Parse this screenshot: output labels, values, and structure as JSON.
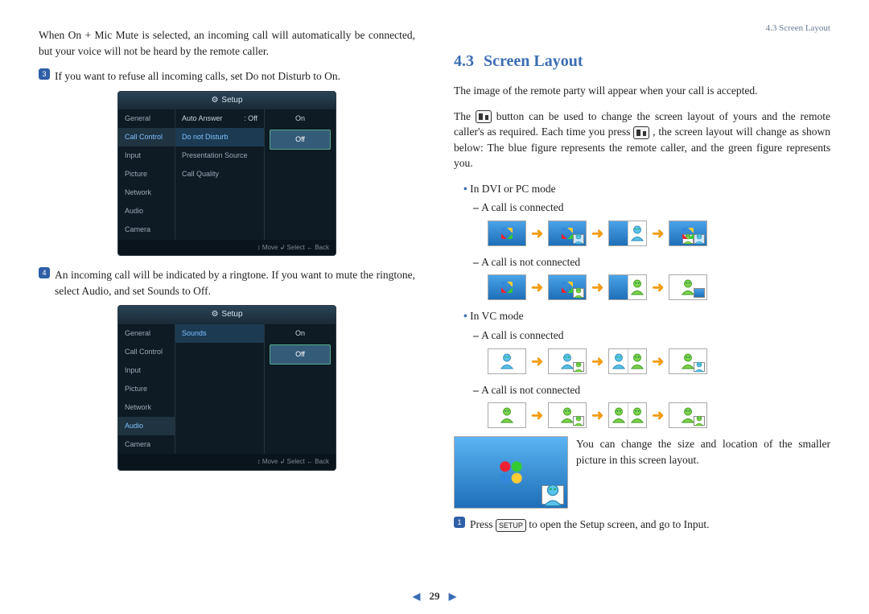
{
  "header": {
    "breadcrumb": "4.3 Screen Layout"
  },
  "left": {
    "intro": "When On + Mic Mute is selected, an incoming call will automatically be connected, but your voice will not be heard by the remote caller.",
    "step3": "If you want to refuse all incoming calls, set Do not Disturb to On.",
    "step4": "An incoming call will be indicated by a ringtone. If you want to mute the ringtone, select Audio, and set Sounds to Off.",
    "badge3": "3",
    "badge4": "4",
    "shot1": {
      "title": "Setup",
      "left": [
        "General",
        "Call Control",
        "Input",
        "Picture",
        "Network",
        "Audio",
        "Camera"
      ],
      "leftSelIndex": 1,
      "mid": [
        {
          "label": "Auto Answer",
          "val": ": Off"
        },
        {
          "label": "Do not Disturb",
          "val": ""
        },
        {
          "label": "Presentation Source",
          "val": ""
        },
        {
          "label": "Call Quality",
          "val": ""
        }
      ],
      "midSelIndex": 1,
      "right": [
        "On",
        "Off"
      ],
      "rightSelIndex": 1,
      "footer": "↕ Move   ↲ Select   ← Back"
    },
    "shot2": {
      "title": "Setup",
      "left": [
        "General",
        "Call Control",
        "Input",
        "Picture",
        "Network",
        "Audio",
        "Camera"
      ],
      "leftSelIndex": 5,
      "mid": [
        {
          "label": "Sounds",
          "val": ""
        }
      ],
      "midSelIndex": 0,
      "right": [
        "On",
        "Off"
      ],
      "rightSelIndex": 1,
      "footer": "↕ Move   ↲ Select   ← Back"
    }
  },
  "right": {
    "title_num": "4.3",
    "title": "Screen Layout",
    "p1": "The image of the remote party will appear when your call is accepted.",
    "p2a": "The ",
    "p2b": " button can be used to change the screen layout of yours and the remote caller's as required. Each time you press ",
    "p2c": " , the screen layout will change as shown below: The blue figure represents the remote caller, and the green figure represents you.",
    "mode1": "In DVI or PC mode",
    "mode2": "In VC mode",
    "sub_connected": "A call is connected",
    "sub_not_connected": "A call is not connected",
    "big_note": "You can change the size and location of the smaller picture in this screen layout.",
    "step1_badge": "1",
    "step1a": "Press ",
    "step1_btn": "SETUP",
    "step1b": " to open the Setup screen, and go to Input."
  },
  "footer": {
    "page": "29"
  }
}
